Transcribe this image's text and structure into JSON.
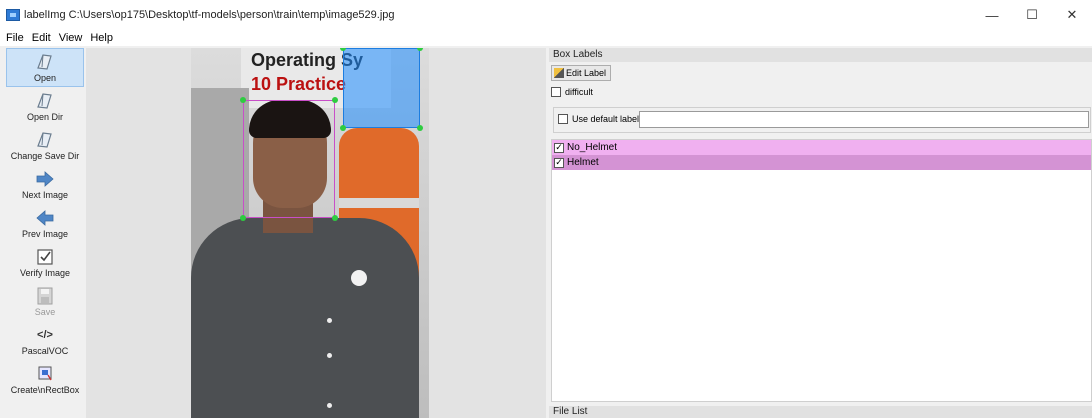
{
  "window": {
    "title": "labelImg C:\\Users\\op175\\Desktop\\tf-models\\person\\train\\temp\\image529.jpg",
    "minimize": "—",
    "maximize": "☐",
    "close": "✕"
  },
  "menu": {
    "file": "File",
    "edit": "Edit",
    "view": "View",
    "help": "Help"
  },
  "toolbar": {
    "open": "Open",
    "open_dir": "Open Dir",
    "change_save_dir": "Change Save Dir",
    "next_image": "Next Image",
    "prev_image": "Prev Image",
    "verify_image": "Verify Image",
    "save": "Save",
    "format": "PascalVOC",
    "format_icon": "</>",
    "create_rect_box": "Create\\nRectBox"
  },
  "canvas": {
    "sign_line1": "Operating Sy",
    "sign_line2": "10 Practice"
  },
  "box_labels": {
    "title": "Box Labels",
    "edit_label": "Edit Label",
    "difficult": "difficult",
    "use_default_label": "Use default label",
    "default_label_value": "",
    "items": [
      {
        "label": "No_Helmet",
        "checked": true,
        "color": "#f0b0f0"
      },
      {
        "label": "Helmet",
        "checked": true,
        "color": "#d493d4"
      }
    ]
  },
  "file_list": {
    "title": "File List"
  }
}
